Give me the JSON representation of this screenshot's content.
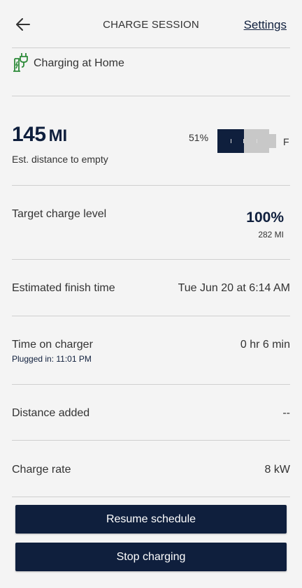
{
  "header": {
    "title": "CHARGE SESSION",
    "settings_label": "Settings"
  },
  "location": {
    "label": "Charging at Home",
    "icon": "ev-plug-icon",
    "icon_color": "#2e8b3a"
  },
  "range": {
    "value": "145",
    "unit": "MI",
    "subtitle": "Est. distance to empty"
  },
  "battery": {
    "percent_label": "51%",
    "level": 0.51,
    "full_label": "F"
  },
  "rows": {
    "target": {
      "label": "Target charge level",
      "percent": "100%",
      "distance": "282 MI"
    },
    "finish": {
      "label": "Estimated finish time",
      "value": "Tue Jun 20 at 6:14 AM"
    },
    "time_on_charger": {
      "label": "Time on charger",
      "value": "0 hr 6 min",
      "sub": "Plugged in: 11:01 PM"
    },
    "distance_added": {
      "label": "Distance added",
      "value": "--"
    },
    "charge_rate": {
      "label": "Charge rate",
      "value": "8 kW"
    }
  },
  "buttons": {
    "resume": "Resume schedule",
    "stop": "Stop charging"
  },
  "colors": {
    "accent": "#0f1f3d",
    "battery_empty": "#c8c8c8",
    "background": "#f4f4f4"
  }
}
